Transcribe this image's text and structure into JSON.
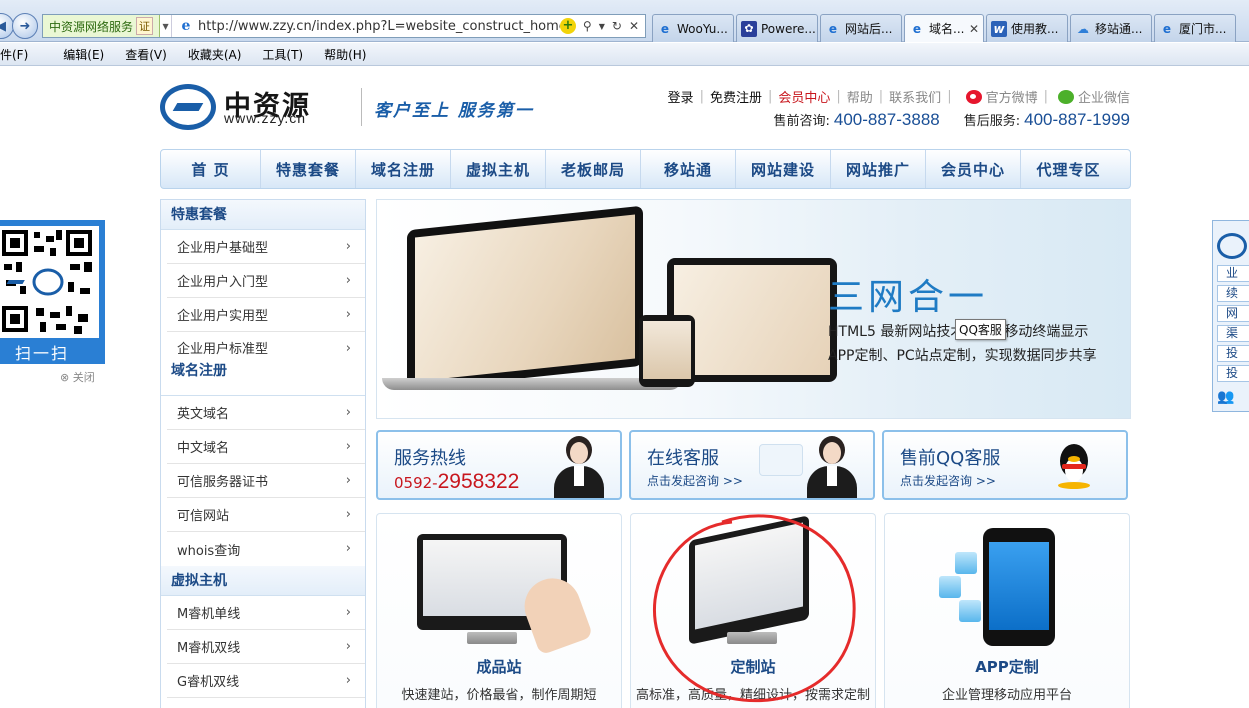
{
  "browser": {
    "address_site_badge": "中资源网络服务",
    "address_cert": "证",
    "url": "http://www.zzy.cn/index.php?L=website_construct_homepage",
    "tabs": [
      {
        "label": "WooYu...",
        "icon": "ie-icon",
        "active": false
      },
      {
        "label": "Powere...",
        "icon": "paw-icon",
        "active": false
      },
      {
        "label": "网站后...",
        "icon": "ie-icon",
        "active": false
      },
      {
        "label": "域名...",
        "icon": "ie-icon",
        "active": true
      },
      {
        "label": "使用教...",
        "icon": "w-icon",
        "active": false
      },
      {
        "label": "移站通...",
        "icon": "cloud-icon",
        "active": false
      },
      {
        "label": "厦门市...",
        "icon": "ie-icon",
        "active": false
      }
    ],
    "menu": [
      "件(F)",
      "编辑(E)",
      "查看(V)",
      "收藏夹(A)",
      "工具(T)",
      "帮助(H)"
    ]
  },
  "header": {
    "logo_cn": "中资源",
    "logo_en": "www.zzy.cn",
    "slogan": "客户至上 服务第一",
    "links": {
      "login": "登录",
      "register": "免费注册",
      "member_center": "会员中心",
      "help": "帮助",
      "contact": "联系我们",
      "weibo": "官方微博",
      "wechat": "企业微信"
    },
    "presale_label": "售前咨询:",
    "presale_phone": "400-887-3888",
    "aftersale_label": "售后服务:",
    "aftersale_phone": "400-887-1999"
  },
  "nav": [
    "首 页",
    "特惠套餐",
    "域名注册",
    "虚拟主机",
    "老板邮局",
    "移站通",
    "网站建设",
    "网站推广",
    "会员中心",
    "代理专区"
  ],
  "sidebar": {
    "sections": [
      {
        "title": "特惠套餐",
        "items": [
          "企业用户基础型",
          "企业用户入门型",
          "企业用户实用型",
          "企业用户标准型"
        ]
      },
      {
        "title": "域名注册",
        "items": [
          "英文域名",
          "中文域名",
          "可信服务器证书",
          "可信网站",
          "whois查询"
        ]
      },
      {
        "title": "虚拟主机",
        "items": [
          "M睿机单线",
          "M睿机双线",
          "G睿机双线"
        ]
      }
    ],
    "chevron": "›"
  },
  "banner": {
    "title": "三网合一",
    "line1": "HTML5 最新网站技术",
    "line1_tail": "移动终端显示",
    "line2": "APP定制、PC站点定制，实现数据同步共享",
    "tooltip": "QQ客服"
  },
  "services": [
    {
      "title": "服务热线",
      "area_code": "0592-",
      "phone": "2958322"
    },
    {
      "title": "在线客服",
      "sub": "点击发起咨询 >>"
    },
    {
      "title": "售前QQ客服",
      "sub": "点击发起咨询 >>"
    }
  ],
  "products": [
    {
      "title": "成品站",
      "desc": "快速建站，价格最省，制作周期短"
    },
    {
      "title": "定制站",
      "desc": "高标准，高质量，精细设计，按需求定制"
    },
    {
      "title": "APP定制",
      "desc": "企业管理移动应用平台"
    }
  ],
  "qr": {
    "label": "扫一扫",
    "close": "⊗ 关闭"
  },
  "right_float": {
    "items": [
      "业",
      "续",
      "网",
      "渠",
      "投",
      "投"
    ]
  },
  "colors": {
    "brand_blue": "#1a5ea8",
    "nav_text": "#1c4a86",
    "accent_red": "#c8161d",
    "annotation_red": "#e52b2b"
  }
}
